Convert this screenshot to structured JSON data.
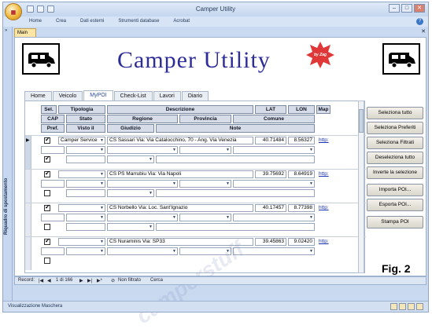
{
  "window": {
    "title": "Camper Utility"
  },
  "menu": [
    "Home",
    "Crea",
    "Dati esterni",
    "Strumenti database",
    "Acrobat"
  ],
  "doc_tab": "Main",
  "left_pane_label": "Riquadro di spostamento",
  "form": {
    "title": "Camper Utility",
    "badge": "by Zag",
    "tabs": [
      "Home",
      "Veicolo",
      "MyPOI",
      "Check-List",
      "Lavori",
      "Diario"
    ],
    "active_tab": "MyPOI",
    "headers_row1": [
      "Sel.",
      "Tipologia",
      "Descrizione",
      "LAT",
      "LON",
      "Map"
    ],
    "headers_row2": [
      "CAP",
      "Stato",
      "Regione",
      "Provincia",
      "Comune"
    ],
    "headers_row3": [
      "Pref.",
      "Visto il",
      "Giudizio",
      "Note"
    ],
    "records": [
      {
        "tipologia": "Camper Service",
        "descrizione": "CS Sassari Via: Via Catalocchino, 70 - Ang. Via Venezia",
        "lat": "40.71484",
        "lon": "8.56327",
        "map": "http:"
      },
      {
        "tipologia": "",
        "descrizione": "CS PS Marrubiu Via: Via Napoli",
        "lat": "39.75692",
        "lon": "8.64919",
        "map": "http:"
      },
      {
        "tipologia": "",
        "descrizione": "CS Norbello Via: Loc. Sant'Ignazio",
        "lat": "40.17457",
        "lon": "8.77398",
        "map": "http:"
      },
      {
        "tipologia": "",
        "descrizione": "CS Nuraminis Via: SP33",
        "lat": "39.45863",
        "lon": "9.02420",
        "map": "http:"
      }
    ],
    "buttons": [
      "Seleziona tutto",
      "Seleziona Preferiti",
      "Seleziona Filtrati",
      "Deseleziona tutto",
      "Inverte la selezione",
      "Importa POI...",
      "Esporta POI...",
      "Stampa POI"
    ]
  },
  "navigation": {
    "record_label": "Record:",
    "position": "1 di 166",
    "filter": "Non filtrato",
    "search": "Cerca"
  },
  "figure_label": "Fig. 2",
  "watermark": "camperstuff",
  "status": "Visualizzazione Maschera"
}
